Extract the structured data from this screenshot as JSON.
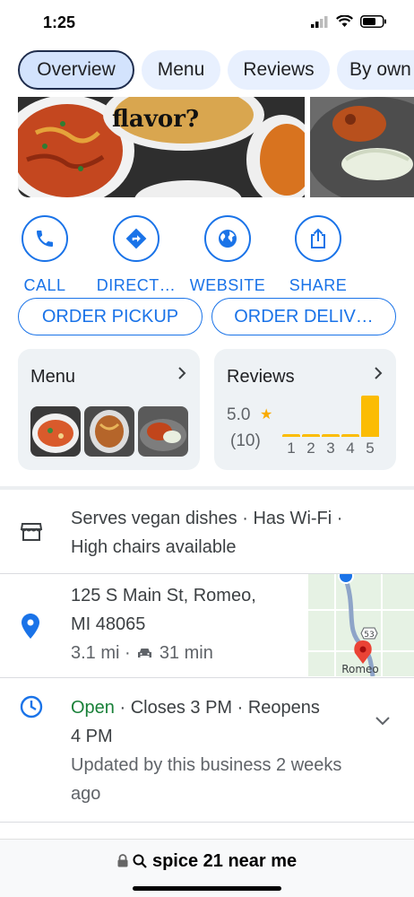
{
  "status": {
    "time": "1:25"
  },
  "tabs": [
    "Overview",
    "Menu",
    "Reviews",
    "By own"
  ],
  "photo": {
    "caption": "flavor?"
  },
  "actions": [
    "CALL",
    "DIRECT…",
    "WEBSITE",
    "SHARE"
  ],
  "order": {
    "pickup": "ORDER PICKUP",
    "delivery": "ORDER DELIV…"
  },
  "menu_card": {
    "title": "Menu"
  },
  "reviews_card": {
    "title": "Reviews",
    "rating": "5.0",
    "star": "★",
    "count": "(10)",
    "distribution": [
      {
        "label": "1",
        "fraction": 0.0
      },
      {
        "label": "2",
        "fraction": 0.0
      },
      {
        "label": "3",
        "fraction": 0.0
      },
      {
        "label": "4",
        "fraction": 0.0
      },
      {
        "label": "5",
        "fraction": 1.0
      }
    ]
  },
  "amenities": {
    "line1": "Serves vegan dishes · Has Wi-Fi ·",
    "line2": "High chairs available"
  },
  "address": {
    "line1": "125 S Main St, Romeo,",
    "line2": "MI 48065",
    "distance": "3.1 mi ·",
    "drive": "31 min"
  },
  "map": {
    "label": "Romeo",
    "route": "53"
  },
  "hours": {
    "status": "Open",
    "closes": " · Closes 3 PM · Reopens",
    "reopen": "4 PM",
    "updated1": "Updated by this business 2 weeks",
    "updated2": "ago"
  },
  "browser": {
    "query": "spice 21 near me"
  },
  "colors": {
    "accent": "#1a73e8",
    "open": "#188038",
    "star": "#fbbc04"
  }
}
